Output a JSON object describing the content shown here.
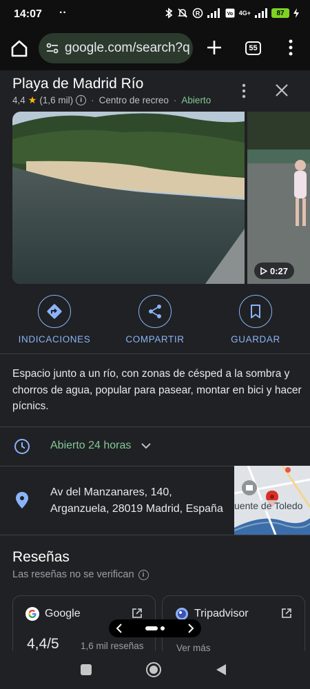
{
  "status_bar": {
    "time": "14:07",
    "extra": "··",
    "network": "4G+",
    "battery": "87"
  },
  "browser": {
    "url": "google.com/search?q",
    "tab_count": "55"
  },
  "place": {
    "name": "Playa de Madrid Río",
    "rating": "4,4",
    "review_count": "(1,6 mil)",
    "category": "Centro de recreo",
    "open_status": "Abierto"
  },
  "media": {
    "video_duration": "0:27"
  },
  "actions": {
    "directions": "INDICACIONES",
    "share": "COMPARTIR",
    "save": "GUARDAR"
  },
  "description": "Espacio junto a un río, con zonas de césped a la sombra y chorros de agua, popular para pasear, montar en bici y hacer pícnics.",
  "hours": {
    "text": "Abierto 24 horas"
  },
  "address": {
    "line1": "Av del Manzanares, 140,",
    "line2": "Arganzuela, 28019 Madrid, España",
    "map_label": "uente de Toledo"
  },
  "reviews": {
    "title": "Reseñas",
    "note": "Las reseñas no se verifican",
    "sources": [
      {
        "name": "Google",
        "rating": "4,4/5",
        "count": "1,6 mil reseñas"
      },
      {
        "name": "Tripadvisor",
        "link": "Ver más"
      }
    ]
  },
  "colors": {
    "accent_blue": "#8ab4f8",
    "open_green": "#81c995",
    "star_yellow": "#fbbc04",
    "background": "#202124"
  }
}
